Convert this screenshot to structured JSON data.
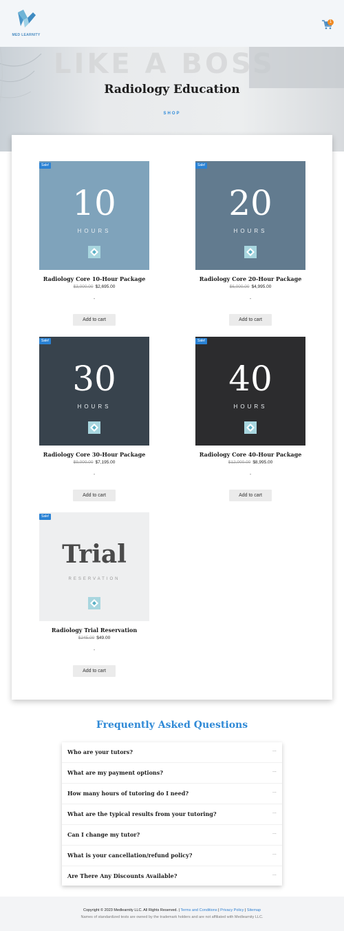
{
  "header": {
    "logo_text": "MED LEARNITY",
    "cart_count": "1"
  },
  "hero": {
    "background_text": "LIKE A BOSS",
    "title": "Radiology Education",
    "breadcrumb": "SHOP"
  },
  "products": [
    {
      "badge": "Sale!",
      "image_number": "10",
      "image_subtitle": "HOURS",
      "image_color": "#7fa3bb",
      "title": "Radiology Core 10-Hour Package",
      "old_price": "$3,000.00",
      "price": "$2,695.00",
      "dash": "-",
      "button": "Add to cart"
    },
    {
      "badge": "Sale!",
      "image_number": "20",
      "image_subtitle": "HOURS",
      "image_color": "#627b8f",
      "title": "Radiology Core 20-Hour Package",
      "old_price": "$6,000.00",
      "price": "$4,995.00",
      "dash": "-",
      "button": "Add to cart"
    },
    {
      "badge": "Sale!",
      "image_number": "30",
      "image_subtitle": "HOURS",
      "image_color": "#38434d",
      "title": "Radiology Core 30-Hour Package",
      "old_price": "$9,000.00",
      "price": "$7,195.00",
      "dash": "-",
      "button": "Add to cart"
    },
    {
      "badge": "Sale!",
      "image_number": "40",
      "image_subtitle": "HOURS",
      "image_color": "#2c2c2e",
      "title": "Radiology Core 40-Hour Package",
      "old_price": "$12,000.00",
      "price": "$8,995.00",
      "dash": "-",
      "button": "Add to cart"
    },
    {
      "badge": "Sale!",
      "image_number": "Trial",
      "image_subtitle": "RESERVATION",
      "image_color": "#eeeff0",
      "title": "Radiology Trial Reservation",
      "old_price": "$245.00",
      "price": "$49.00",
      "dash": "-",
      "button": "Add to cart"
    }
  ],
  "faq": {
    "title": "Frequently Asked Questions",
    "items": [
      {
        "question": "Who are your tutors?",
        "icon": "..."
      },
      {
        "question": "What are my payment options?",
        "icon": "..."
      },
      {
        "question": "How many hours of tutoring do I need?",
        "icon": "..."
      },
      {
        "question": "What are the typical results from your tutoring?",
        "icon": "..."
      },
      {
        "question": "Can I change my tutor?",
        "icon": "..."
      },
      {
        "question": "What is your cancellation/refund policy?",
        "icon": "..."
      },
      {
        "question": "Are There Any Discounts Available?",
        "icon": "..."
      }
    ]
  },
  "footer": {
    "copyright": "Copyright © 2023 Medlearnity LLC. All Rights Reserved. |",
    "terms": "Terms and Conditions",
    "privacy": "Privacy Policy",
    "sitemap": "Sitemap",
    "sep": "|",
    "disclaimer": "Names of standardized tests are owned by the trademark holders and are not affiliated with Medlearnity LLC."
  },
  "colors": {
    "accent": "#2f89d6",
    "sale_badge": "#2a82d4",
    "cart_badge": "#f08a24"
  }
}
